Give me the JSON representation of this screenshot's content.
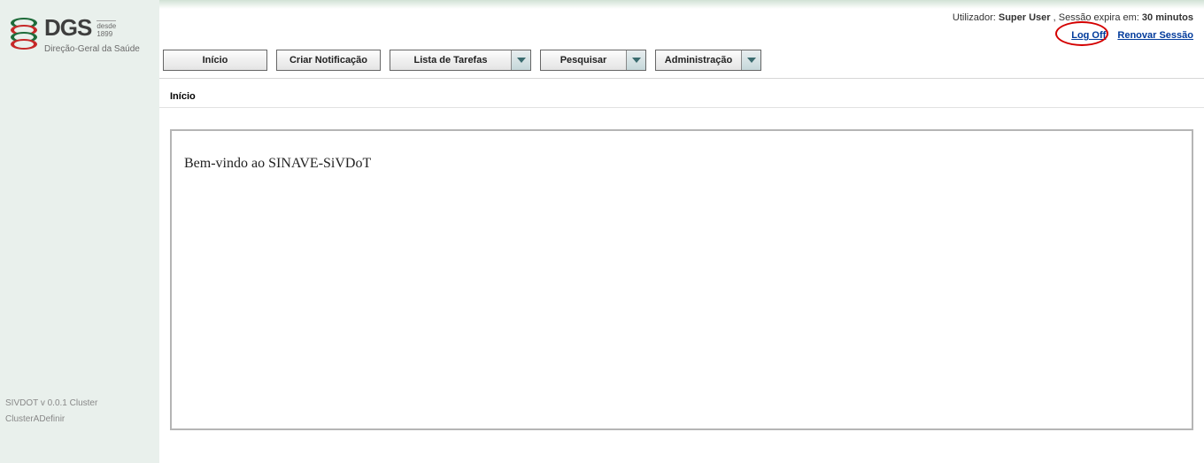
{
  "brand": {
    "abbrev": "DGS",
    "since_label": "desde",
    "since_year": "1899",
    "subtitle": "Direção-Geral da Saúde"
  },
  "userbar": {
    "user_label": "Utilizador:",
    "user_name": "Super User",
    "session_label": ", Sessão expira em:",
    "session_value": "30 minutos"
  },
  "links": {
    "logoff": "Log Off",
    "renew": "Renovar Sessão"
  },
  "nav": {
    "inicio": "Início",
    "criar": "Criar Notificação",
    "lista": "Lista de Tarefas",
    "pesquisar": "Pesquisar",
    "admin": "Administração"
  },
  "page": {
    "title": "Início",
    "welcome": "Bem-vindo ao SINAVE-SiVDoT"
  },
  "footer": {
    "version": "SIVDOT v 0.0.1 Cluster",
    "cluster": "ClusterADefinir"
  }
}
